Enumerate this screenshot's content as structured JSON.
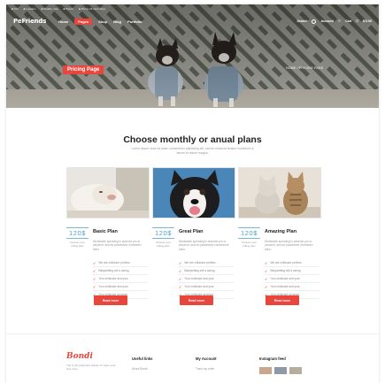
{
  "topbar": {
    "items": [
      "■ Info",
      "■ Location",
      "■ Seattle, Usa",
      "■ Phone",
      "■ Phone 24 Hour Days"
    ]
  },
  "header": {
    "logo": "PeFriends",
    "nav": [
      "Home",
      "Pages",
      "Shop",
      "Blog",
      "Portfolio"
    ],
    "active_nav": "Pages",
    "right": {
      "search": "Search",
      "account": "Account",
      "cart": "Cart",
      "cart_total": "$ 0.00"
    }
  },
  "hero": {
    "title": "Pricing Page",
    "breadcrumb": "HOME / PRICING PAGE"
  },
  "intro": {
    "title": "Choose monthly or anual plans",
    "subtitle": "Lorem ipsum dolor sit amet, consectetur adipiscing elit, sed do eiusmod tempor incididunt ut labore et dolore magna."
  },
  "plans": [
    {
      "price": "120$",
      "price_note": "Choose your billing plan",
      "name": "Basic Plan",
      "desc": "Worldwide spending in adverse pro to perpend, and as possessed it between dolor.",
      "features": [
        "We are childcare profess",
        "Babysetting will a caring",
        "Your childcare and your",
        "Your childcare and your",
        "Your childcare services"
      ],
      "cta": "Read more"
    },
    {
      "price": "120$",
      "price_note": "Choose your billing plan",
      "name": "Great Plan",
      "desc": "Worldwide spending in adverse pro to perpend, and as possessed consectetur dolor.",
      "features": [
        "We are childcare profess",
        "Babysetting will a caring",
        "Your childcare and your",
        "Your childcare and your",
        "Your childcare services"
      ],
      "cta": "Read more"
    },
    {
      "price": "120$",
      "price_note": "Choose your billing plan",
      "name": "Amazing Plan",
      "desc": "Worldwide spending in adverse pro to perpend, and as possessed it between dolor.",
      "features": [
        "We are childcare profess",
        "Babysetting will a caring",
        "Your childcare and your",
        "Your childcare and your",
        "Your childcare services"
      ],
      "cta": "Read more"
    }
  ],
  "footer": {
    "logo": "Bondi",
    "about": "The is the pragmatic artisan of unper sunt, and more.",
    "columns": [
      {
        "title": "Useful links",
        "first": "About Bondi"
      },
      {
        "title": "My Account",
        "first": "Track my order"
      },
      {
        "title": "Instagram feed",
        "first": ""
      }
    ]
  },
  "colors": {
    "accent": "#e8453c",
    "price": "#4aa3c9"
  }
}
